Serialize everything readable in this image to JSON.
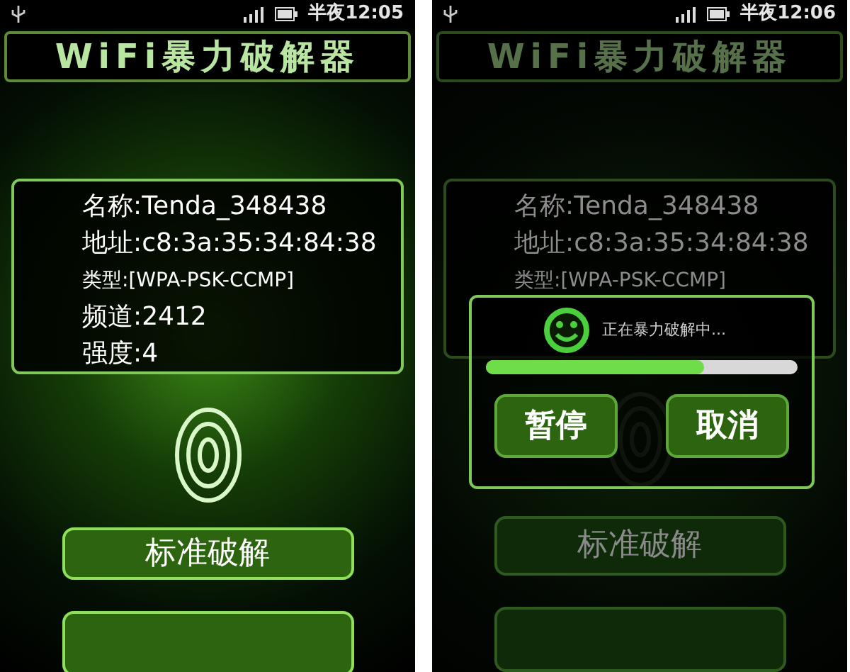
{
  "screens": [
    {
      "dimmed": false,
      "status_bar": {
        "time": "半夜12:05"
      },
      "title": "WiFi暴力破解器",
      "info": [
        "名称:Tenda_348438",
        "地址:c8:3a:35:34:84:38",
        "类型:[WPA-PSK-CCMP]",
        "频道:2412",
        "强度:4"
      ],
      "buttons": [
        {
          "label": "标准破解"
        }
      ]
    },
    {
      "dimmed": true,
      "status_bar": {
        "time": "半夜12:06"
      },
      "title": "WiFi暴力破解器",
      "info": [
        "名称:Tenda_348438",
        "地址:c8:3a:35:34:84:38",
        "类型:[WPA-PSK-CCMP]"
      ],
      "buttons": [
        {
          "label": "标准破解"
        }
      ],
      "dialog": {
        "message": "正在暴力破解中...",
        "level": 0.7,
        "buttons": [
          {
            "label": "暂停"
          },
          {
            "label": "取消"
          }
        ]
      }
    }
  ]
}
